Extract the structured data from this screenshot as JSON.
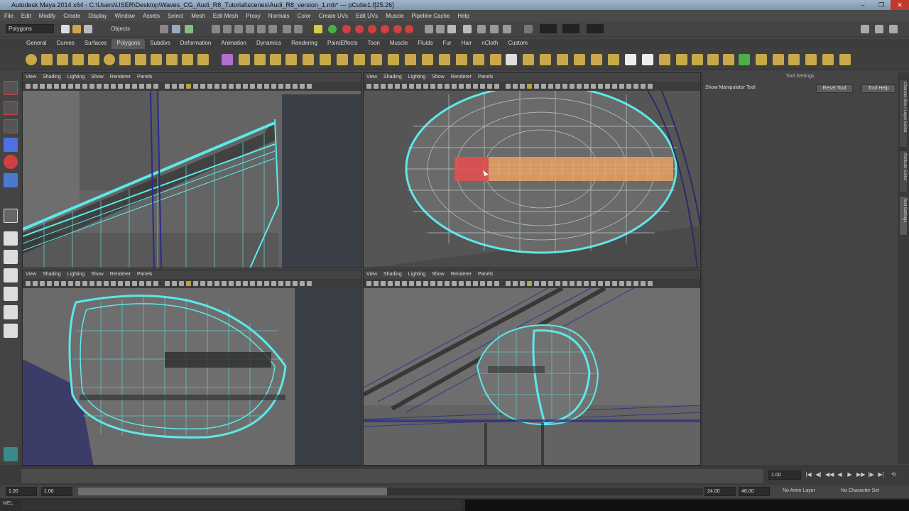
{
  "window": {
    "title": "Autodesk Maya 2014 x64 - C:\\Users\\USER\\Desktop\\Waves_CG_Audi_R8_Tutorial\\scenes\\Audi_R8_version_1.mb* --- pCube1.f[25:26]",
    "controls": [
      "–",
      "❐",
      "✕"
    ]
  },
  "menubar": [
    "File",
    "Edit",
    "Modify",
    "Create",
    "Display",
    "Window",
    "Assets",
    "Select",
    "Mesh",
    "Edit Mesh",
    "Proxy",
    "Normals",
    "Color",
    "Create UVs",
    "Edit UVs",
    "Muscle",
    "Pipeline Cache",
    "Help"
  ],
  "statusline": {
    "mode": "Polygons",
    "object_label": "Objects"
  },
  "shelf_tabs": [
    "General",
    "Curves",
    "Surfaces",
    "Polygons",
    "Subdivs",
    "Deformation",
    "Animation",
    "Dynamics",
    "Rendering",
    "PaintEffects",
    "Toon",
    "Muscle",
    "Fluids",
    "Fur",
    "Hair",
    "nCloth",
    "Custom"
  ],
  "active_shelf_tab": "Polygons",
  "panel_menu": [
    "View",
    "Shading",
    "Lighting",
    "Show",
    "Renderer",
    "Panels"
  ],
  "right_panel": {
    "header": "Tool Settings",
    "tool_name": "Show Manipulator Tool",
    "buttons": [
      "Reset Tool",
      "Tool Help"
    ],
    "side_tabs": [
      "Channel Box / Layer Editor",
      "Attribute Editor",
      "Tool Settings"
    ]
  },
  "timeslider": {
    "current_frame": "1.00"
  },
  "range": {
    "start": "1.00",
    "start_inner": "1.00",
    "end_inner": "24.00",
    "end": "48.00",
    "anim_layer": "No Anim Layer",
    "char_set": "No Character Set"
  },
  "cmdline": {
    "label": "MEL"
  },
  "colors": {
    "background": "#444444",
    "viewport": "#5d5d5d",
    "wire_selected": "#5ee8e8",
    "wire_other": "#2a2a8a",
    "face_selected": "#e8a060",
    "face_hilite": "#e05050"
  }
}
